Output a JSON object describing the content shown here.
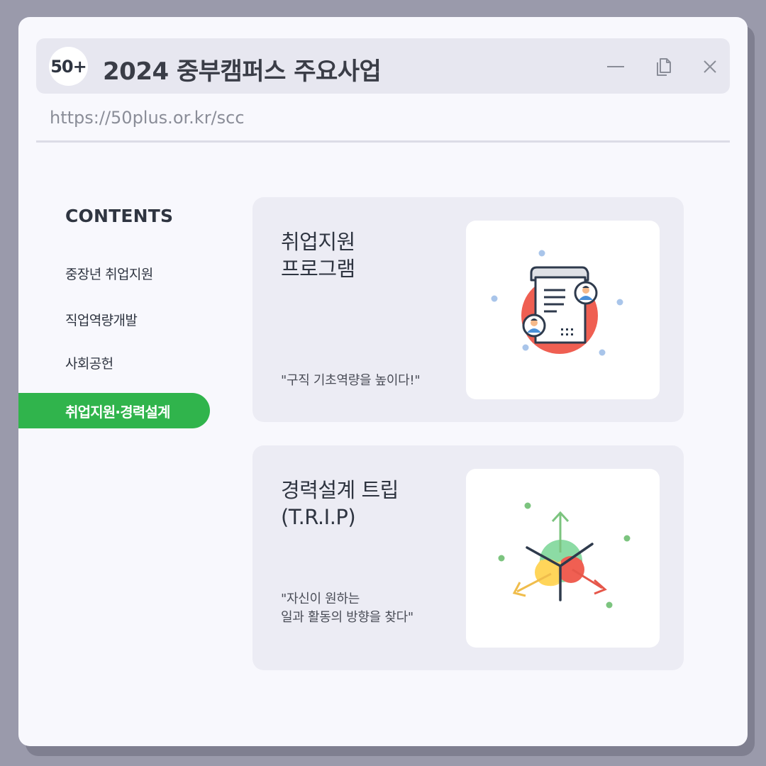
{
  "window": {
    "logo_text": "50+",
    "title": "2024 중부캠퍼스 주요사업",
    "url": "https://50plus.or.kr/scc"
  },
  "sidebar": {
    "heading": "CONTENTS",
    "items": [
      {
        "label": "중장년 취업지원",
        "active": false
      },
      {
        "label": "직업역량개발",
        "active": false
      },
      {
        "label": "사회공헌",
        "active": false
      },
      {
        "label": "취업지원·경력설계",
        "active": true
      }
    ]
  },
  "cards": [
    {
      "title_lines": [
        "취업지원",
        "프로그램"
      ],
      "subtitle_lines": [
        "\"구직 기초역량을 높이다!\""
      ],
      "icon": "document-profiles-icon"
    },
    {
      "title_lines": [
        "경력설계 트립",
        "(T.R.I.P)"
      ],
      "subtitle_lines": [
        "\"자신이 원하는",
        "일과 활동의 방향을 찾다\""
      ],
      "icon": "direction-arrows-icon"
    }
  ],
  "colors": {
    "accent_green": "#30b44c",
    "window_bg": "#f8f8fd",
    "card_bg": "#ececf4",
    "text_dark": "#2f3541"
  }
}
